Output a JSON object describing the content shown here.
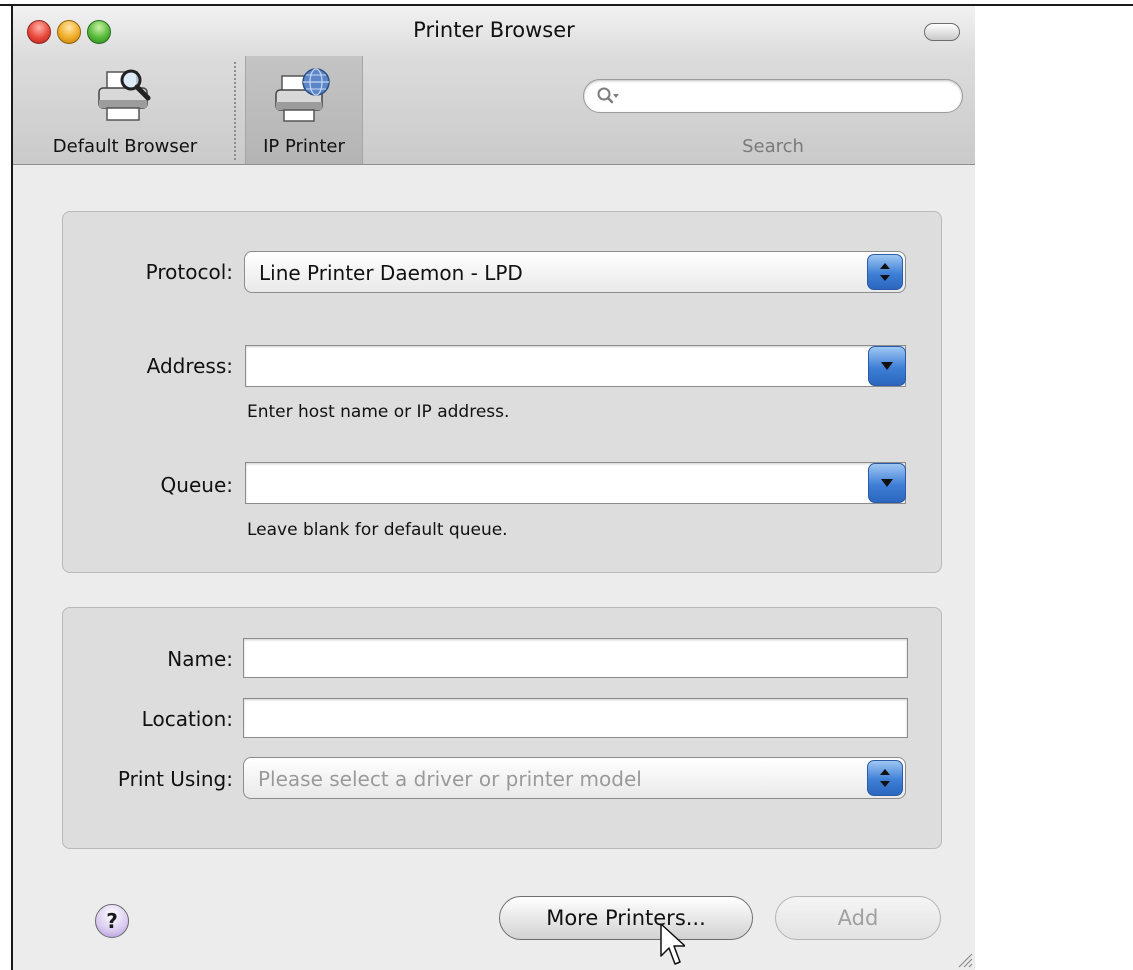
{
  "window": {
    "title": "Printer Browser"
  },
  "toolbar": {
    "items": [
      {
        "label": "Default Browser",
        "icon": "printer-magnifier-icon"
      },
      {
        "label": "IP Printer",
        "icon": "printer-globe-icon",
        "selected": true
      }
    ],
    "search": {
      "label": "Search",
      "value": "",
      "placeholder": ""
    }
  },
  "connection": {
    "protocol_label": "Protocol:",
    "protocol_value": "Line Printer Daemon - LPD",
    "address_label": "Address:",
    "address_value": "",
    "address_hint": "Enter host name or IP address.",
    "queue_label": "Queue:",
    "queue_value": "",
    "queue_hint": "Leave blank for default queue."
  },
  "printer": {
    "name_label": "Name:",
    "name_value": "",
    "location_label": "Location:",
    "location_value": "",
    "print_using_label": "Print Using:",
    "print_using_value": "Please select a driver or printer model"
  },
  "footer": {
    "help_label": "?",
    "more_printers_label": "More Printers...",
    "add_label": "Add"
  },
  "colors": {
    "accent": "#3f7fd6",
    "close": "#e8473a",
    "minimize": "#f0ac27",
    "zoom": "#54b93a"
  }
}
